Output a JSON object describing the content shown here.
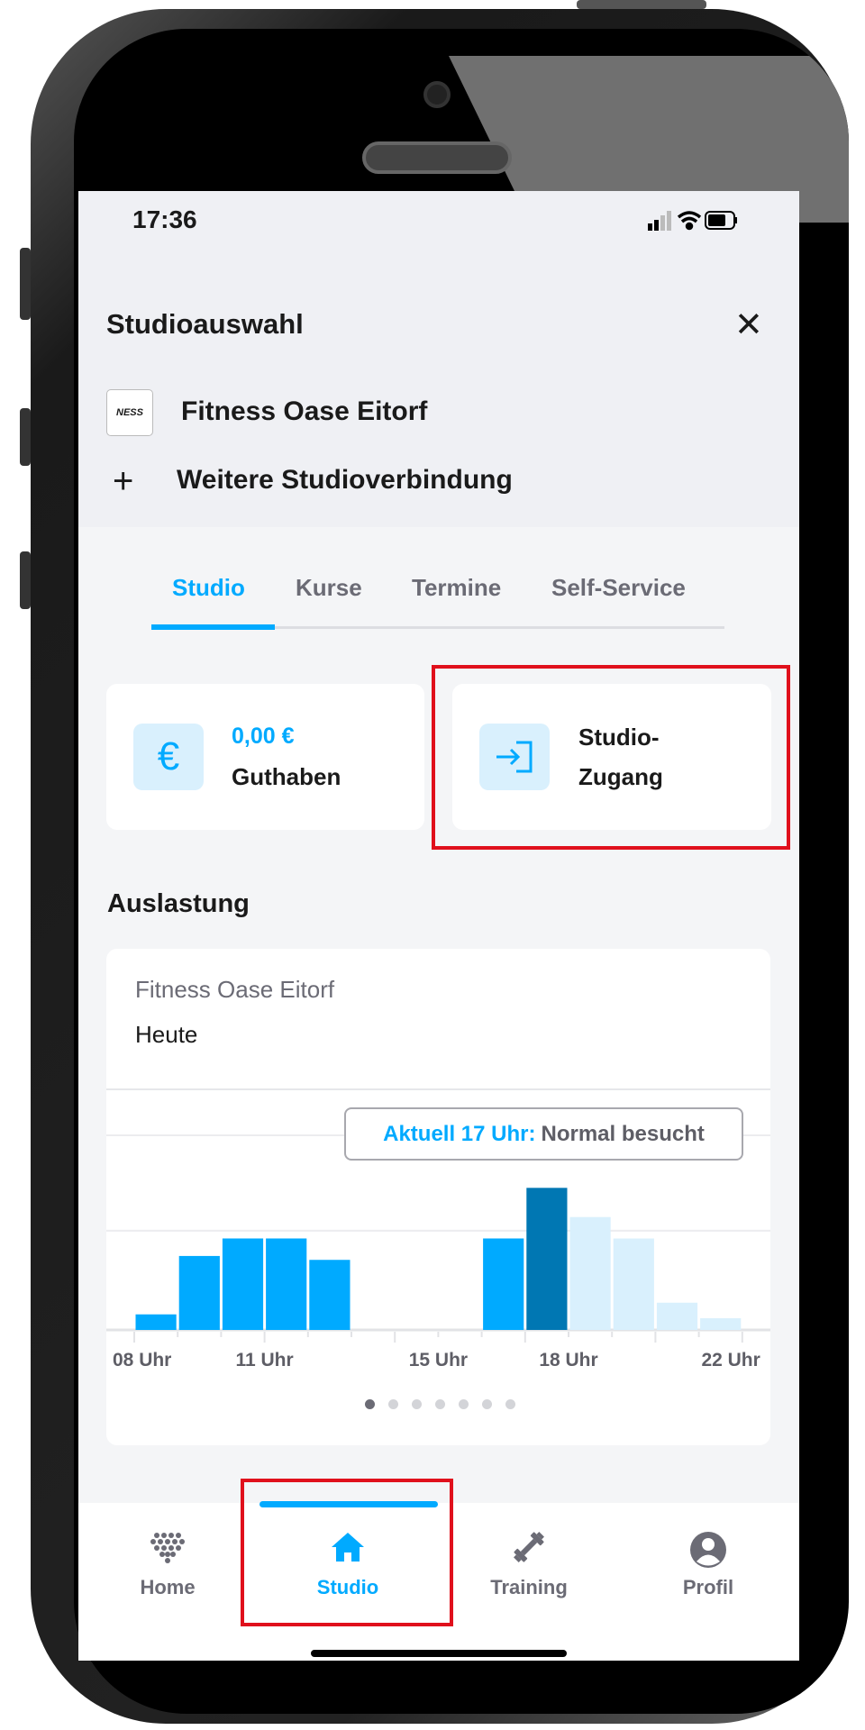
{
  "status_bar": {
    "time": "17:36"
  },
  "header": {
    "title": "Studioauswahl",
    "studio_name": "Fitness Oase Eitorf",
    "logo_text": "NESS",
    "add_connection": "Weitere Studioverbindung"
  },
  "tabs": [
    {
      "label": "Studio",
      "active": true
    },
    {
      "label": "Kurse"
    },
    {
      "label": "Termine"
    },
    {
      "label": "Self-Service"
    }
  ],
  "cards": {
    "balance_value": "0,00 €",
    "balance_label": "Guthaben",
    "access_line1": "Studio-",
    "access_line2": "Zugang"
  },
  "section_title": "Auslastung",
  "chart_card": {
    "studio": "Fitness Oase Eitorf",
    "day": "Heute",
    "tooltip_prefix": "Aktuell 17 Uhr:",
    "tooltip_status": "Normal besucht",
    "pages": 7,
    "current_page": 1
  },
  "chart_data": {
    "type": "bar",
    "x_tick_labels": [
      "08 Uhr",
      "11 Uhr",
      "15 Uhr",
      "18 Uhr",
      "22 Uhr"
    ],
    "categories": [
      "08",
      "09",
      "10",
      "11",
      "12",
      "13",
      "14",
      "15",
      "16",
      "17",
      "18",
      "19",
      "20",
      "21"
    ],
    "values": [
      8,
      38,
      47,
      47,
      36,
      0,
      0,
      0,
      47,
      73,
      58,
      47,
      14,
      6
    ],
    "states": [
      "past",
      "past",
      "past",
      "past",
      "past",
      "past",
      "past",
      "past",
      "past",
      "current",
      "forecast",
      "forecast",
      "forecast",
      "forecast"
    ],
    "ylim": [
      0,
      100
    ],
    "grid": true,
    "colors": {
      "past": "#00aaff",
      "current": "#0077b3",
      "forecast": "#d9f0fd"
    }
  },
  "nav": [
    {
      "label": "Home",
      "icon": "home-dots-icon"
    },
    {
      "label": "Studio",
      "icon": "house-icon",
      "active": true
    },
    {
      "label": "Training",
      "icon": "dumbbell-icon"
    },
    {
      "label": "Profil",
      "icon": "profile-icon"
    }
  ],
  "colors": {
    "accent": "#00aaff",
    "highlight_box": "#e0101c"
  }
}
